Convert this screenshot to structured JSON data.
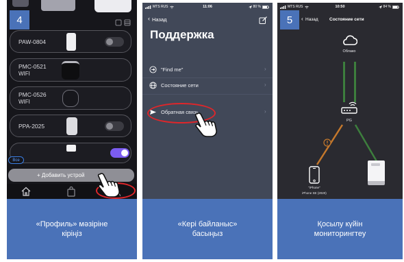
{
  "theme": {
    "caption_bg": "#4a72b8",
    "highlight": "#e0262a",
    "toggle_on": "#7b5cf0",
    "link_ok": "#3d7e3d",
    "link_warn": "#c4782c"
  },
  "panel1": {
    "step_badge": "4",
    "devices": [
      {
        "name": "PAW-0804",
        "toggle": 0
      },
      {
        "name": "PMC-0521",
        "subtitle": "WIFI"
      },
      {
        "name": "PMC-0526",
        "subtitle": "WIFI"
      },
      {
        "name": "PPA-2025",
        "toggle": 0
      },
      {
        "toggle": 1
      }
    ],
    "filter_tag": "Все",
    "add_button_label": "+ Добавить устрой",
    "tab_bar_icons": [
      "home-icon",
      "bag-icon",
      "profile-icon"
    ],
    "caption": {
      "line1": "«Профиль» мәзіріне",
      "line2": "кіріңіз"
    }
  },
  "panel2": {
    "status_bar": {
      "carrier": "MTS RUS",
      "time": "11:06",
      "battery": "80 %"
    },
    "back_label": "Назад",
    "title": "Поддержка",
    "menu_items": [
      {
        "label": "\"Find me\"",
        "icon": "arrow-circle-icon"
      },
      {
        "label": "Состояние сети",
        "icon": "globe-icon"
      },
      {
        "label": "Обратная связь",
        "icon": "send-icon"
      }
    ],
    "caption": {
      "line1": "«Кері байланыс»",
      "line2": "басыңыз"
    }
  },
  "panel3": {
    "step_badge": "5",
    "status_bar": {
      "carrier": "MTS RUS",
      "time": "10:50",
      "battery": "84 %"
    },
    "back_label": "Назад",
    "title": "Состояние сети",
    "network": {
      "cloud_label": "Облако",
      "router_label": "PG",
      "phone_name": "\"iPhone\"",
      "phone_model": "iPhone SE (2020)"
    },
    "caption": {
      "line1": "Қосылу күйін",
      "line2": "мониторингтеу"
    }
  }
}
